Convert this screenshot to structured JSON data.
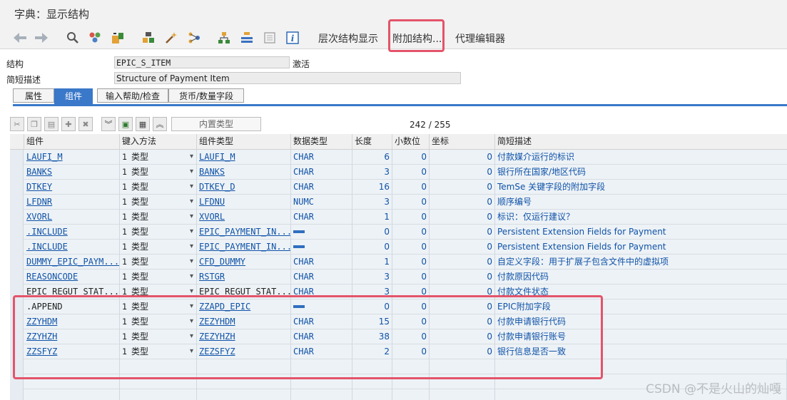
{
  "window": {
    "title": "字典：显示结构"
  },
  "toolbar": {
    "icons": [
      "back-arrow-icon",
      "forward-arrow-icon",
      "other-object-icon",
      "display-change-icon",
      "activate-icon",
      "check-icon",
      "where-used-icon",
      "navigate-icon",
      "hierarchy-icon",
      "display-object-list-icon",
      "documentation-icon",
      "info-icon"
    ],
    "hierarchy_label": "层次结构显示",
    "append_label": "附加结构...",
    "proxy_label": "代理编辑器"
  },
  "header": {
    "struct_label": "结构",
    "struct_value": "EPIC_S_ITEM",
    "status": "激活",
    "desc_label": "简短描述",
    "desc_value": "Structure of Payment Item"
  },
  "tabs": [
    {
      "label": "属性",
      "active": false
    },
    {
      "label": "组件",
      "active": true
    },
    {
      "label": "输入帮助/检查",
      "active": false
    },
    {
      "label": "货币/数量字段",
      "active": false
    }
  ],
  "grid_toolbar": {
    "builtin_type_label": "内置类型",
    "count": "242  /  255"
  },
  "columns": [
    "组件",
    "键入方法",
    "组件类型",
    "数据类型",
    "长度",
    "小数位",
    "坐标",
    "简短描述"
  ],
  "rows": [
    {
      "component": "LAUFI_M",
      "method_num": "1",
      "method": "类型",
      "ctype": "LAUFI_M",
      "dtype": "CHAR",
      "len": "6",
      "dec": "0",
      "coord": "0",
      "desc": "付款媒介运行的标识",
      "link": true
    },
    {
      "component": "BANKS",
      "method_num": "1",
      "method": "类型",
      "ctype": "BANKS",
      "dtype": "CHAR",
      "len": "3",
      "dec": "0",
      "coord": "0",
      "desc": "银行所在国家/地区代码",
      "link": true
    },
    {
      "component": "DTKEY",
      "method_num": "1",
      "method": "类型",
      "ctype": "DTKEY_D",
      "dtype": "CHAR",
      "len": "16",
      "dec": "0",
      "coord": "0",
      "desc": "TemSe 关键字段的附加字段",
      "link": true
    },
    {
      "component": "LFDNR",
      "method_num": "1",
      "method": "类型",
      "ctype": "LFDNU",
      "dtype": "NUMC",
      "len": "3",
      "dec": "0",
      "coord": "0",
      "desc": "顺序编号",
      "link": true
    },
    {
      "component": "XVORL",
      "method_num": "1",
      "method": "类型",
      "ctype": "XVORL",
      "dtype": "CHAR",
      "len": "1",
      "dec": "0",
      "coord": "0",
      "desc": "标识：仅运行建议？",
      "link": true
    },
    {
      "component": ".INCLUDE",
      "method_num": "1",
      "method": "类型",
      "ctype": "EPIC_PAYMENT_IN...",
      "dtype": "",
      "len": "0",
      "dec": "0",
      "coord": "0",
      "desc": "Persistent Extension Fields for Payment",
      "link": true,
      "struct": true
    },
    {
      "component": ".INCLUDE",
      "method_num": "1",
      "method": "类型",
      "ctype": "EPIC_PAYMENT_IN...",
      "dtype": "",
      "len": "0",
      "dec": "0",
      "coord": "0",
      "desc": "Persistent Extension Fields for Payment",
      "link": true,
      "struct": true
    },
    {
      "component": "DUMMY_EPIC_PAYM...",
      "method_num": "1",
      "method": "类型",
      "ctype": "CFD_DUMMY",
      "dtype": "CHAR",
      "len": "1",
      "dec": "0",
      "coord": "0",
      "desc": "自定义字段：用于扩展子包含文件中的虚拟项",
      "link": true
    },
    {
      "component": "REASONCODE",
      "method_num": "1",
      "method": "类型",
      "ctype": "RSTGR",
      "dtype": "CHAR",
      "len": "3",
      "dec": "0",
      "coord": "0",
      "desc": "付款原因代码",
      "link": true
    },
    {
      "component": "EPIC_REGUT_STAT...",
      "method_num": "1",
      "method": "类型",
      "ctype": "EPIC_REGUT_STAT...",
      "dtype": "CHAR",
      "len": "3",
      "dec": "0",
      "coord": "0",
      "desc": "付款文件状态",
      "link": false
    },
    {
      "component": ".APPEND",
      "method_num": "1",
      "method": "类型",
      "ctype": "ZZAPD_EPIC",
      "dtype": "",
      "len": "0",
      "dec": "0",
      "coord": "0",
      "desc": "EPIC附加字段",
      "link": false,
      "struct": true
    },
    {
      "component": "ZZYHDM",
      "method_num": "1",
      "method": "类型",
      "ctype": "ZEZYHDM",
      "dtype": "CHAR",
      "len": "15",
      "dec": "0",
      "coord": "0",
      "desc": "付款申请银行代码",
      "link": true
    },
    {
      "component": "ZZYHZH",
      "method_num": "1",
      "method": "类型",
      "ctype": "ZEZYHZH",
      "dtype": "CHAR",
      "len": "38",
      "dec": "0",
      "coord": "0",
      "desc": "付款申请银行账号",
      "link": true
    },
    {
      "component": "ZZSFYZ",
      "method_num": "1",
      "method": "类型",
      "ctype": "ZEZSFYZ",
      "dtype": "CHAR",
      "len": "2",
      "dec": "0",
      "coord": "0",
      "desc": "银行信息是否一致",
      "link": true
    }
  ],
  "watermark": "CSDN @不是火山的灿嘎",
  "colors": {
    "highlight": "#e3546a",
    "tab_active": "#3a78c9",
    "link": "#0f52a8"
  }
}
